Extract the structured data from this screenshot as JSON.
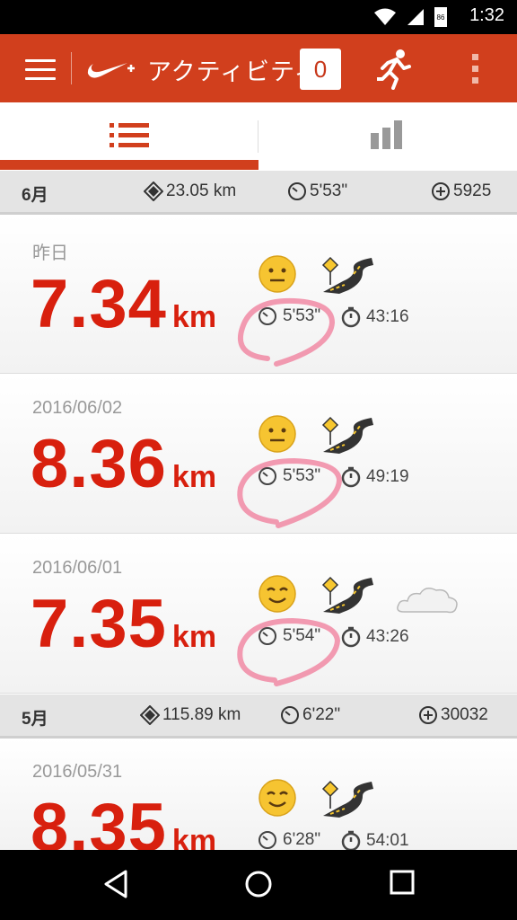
{
  "status": {
    "time": "1:32",
    "battery": "86"
  },
  "app": {
    "title": "アクティビティ",
    "badge": "0"
  },
  "months": [
    {
      "label": "6月",
      "distance": "23.05 km",
      "pace": "5'53\"",
      "fuel": "5925"
    },
    {
      "label": "5月",
      "distance": "115.89 km",
      "pace": "6'22\"",
      "fuel": "30032"
    }
  ],
  "runs": [
    {
      "date": "昨日",
      "distance": "7.34",
      "unit": "km",
      "pace": "5'53\"",
      "duration": "43:16",
      "mood": "neutral",
      "terrain": "road",
      "weather": ""
    },
    {
      "date": "2016/06/02",
      "distance": "8.36",
      "unit": "km",
      "pace": "5'53\"",
      "duration": "49:19",
      "mood": "neutral",
      "terrain": "road",
      "weather": ""
    },
    {
      "date": "2016/06/01",
      "distance": "7.35",
      "unit": "km",
      "pace": "5'54\"",
      "duration": "43:26",
      "mood": "happy",
      "terrain": "road",
      "weather": "cloudy"
    },
    {
      "date": "2016/05/31",
      "distance": "8.35",
      "unit": "km",
      "pace": "6'28\"",
      "duration": "54:01",
      "mood": "happy",
      "terrain": "road",
      "weather": ""
    }
  ],
  "colors": {
    "accent": "#d13f1d",
    "distance": "#d8200e",
    "annotation": "#f07b9a"
  }
}
